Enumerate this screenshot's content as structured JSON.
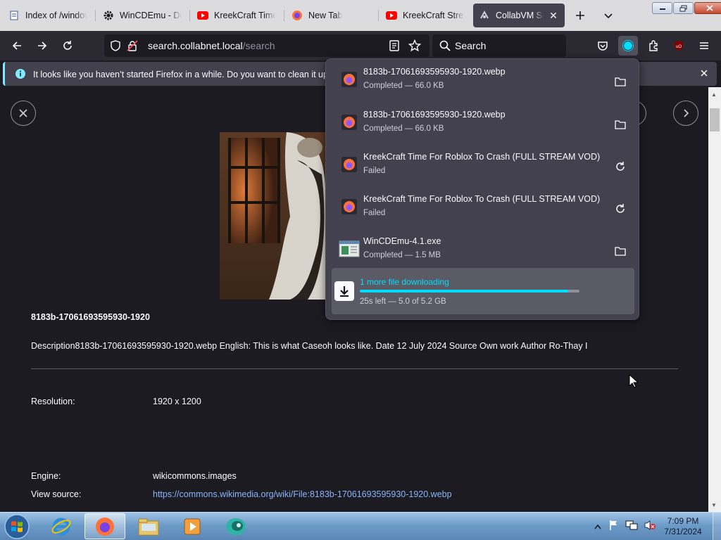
{
  "tabs": [
    {
      "label": "Index of /window",
      "icon": "doc-icon"
    },
    {
      "label": "WinCDEmu - Do",
      "icon": "gear-icon"
    },
    {
      "label": "KreekCraft Time",
      "icon": "youtube-icon"
    },
    {
      "label": "New Tab",
      "icon": "firefox-icon"
    },
    {
      "label": "KreekCraft Strea",
      "icon": "youtube-icon"
    },
    {
      "label": "CollabVM Sea",
      "icon": "collabvm-icon"
    }
  ],
  "toolbar": {
    "url_host": "search.collabnet.local",
    "url_path": "/search",
    "search_placeholder": "Search"
  },
  "notification": {
    "text": "It looks like you haven’t started Firefox in a while. Do you want to clean it up for"
  },
  "image_page": {
    "title": "8183b-17061693595930-1920",
    "description": "Description8183b-17061693595930-1920.webp English: This is what Caseoh looks like. Date 12 July 2024 Source Own work Author Ro-Thay I",
    "resolution_label": "Resolution:",
    "resolution_value": "1920 x 1200",
    "engine_label": "Engine:",
    "engine_value": "wikicommons.images",
    "source_label": "View source:",
    "source_value": "https://commons.wikimedia.org/wiki/File:8183b-17061693595930-1920.webp"
  },
  "downloads": {
    "items": [
      {
        "name": "8183b-17061693595930-1920.webp",
        "status": "Completed — 66.0 KB",
        "icon": "firefox-file-icon",
        "action": "folder-icon"
      },
      {
        "name": "8183b-17061693595930-1920.webp",
        "status": "Completed — 66.0 KB",
        "icon": "firefox-file-icon",
        "action": "folder-icon"
      },
      {
        "name": "KreekCraft Time For Roblox To Crash (FULL STREAM VOD) - YouTube",
        "status": "Failed",
        "icon": "firefox-file-icon",
        "action": "retry-icon"
      },
      {
        "name": "KreekCraft Time For Roblox To Crash (FULL STREAM VOD) - YouTube",
        "status": "Failed",
        "icon": "firefox-file-icon",
        "action": "retry-icon"
      },
      {
        "name": "WinCDEmu-4.1.exe",
        "status": "Completed — 1.5 MB",
        "icon": "exe-file-icon",
        "action": "folder-icon"
      }
    ],
    "summary": {
      "link": "1 more file downloading",
      "status": "25s left — 5.0 of 5.2 GB",
      "progress": 0.95
    }
  },
  "clock": {
    "time": "7:09 PM",
    "date": "7/31/2024"
  },
  "colors": {
    "accent": "#00ddff",
    "page_bg": "#1c1b22",
    "panel_bg": "#42414d",
    "link": "#8ab4f8"
  }
}
